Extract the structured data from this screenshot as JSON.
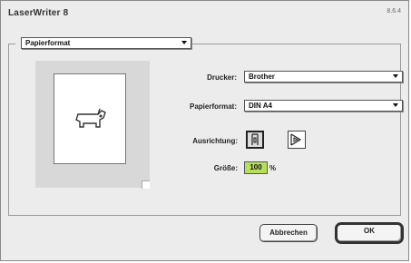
{
  "window": {
    "title": "LaserWriter 8",
    "version": "8.6.4"
  },
  "panel_popup": {
    "value": "Papierformat"
  },
  "printer": {
    "label": "Drucker:",
    "value": "Brother"
  },
  "paper": {
    "label": "Papierformat:",
    "value": "DIN A4"
  },
  "orientation": {
    "label": "Ausrichtung:",
    "portrait_icon": "portrait-dog-icon",
    "landscape_icon": "landscape-dog-icon",
    "selected": "portrait"
  },
  "scale": {
    "label": "Größe:",
    "value": "100",
    "unit": "%"
  },
  "buttons": {
    "cancel": "Abbrechen",
    "ok": "OK"
  },
  "colors": {
    "scale_highlight": "#b6e05a"
  }
}
